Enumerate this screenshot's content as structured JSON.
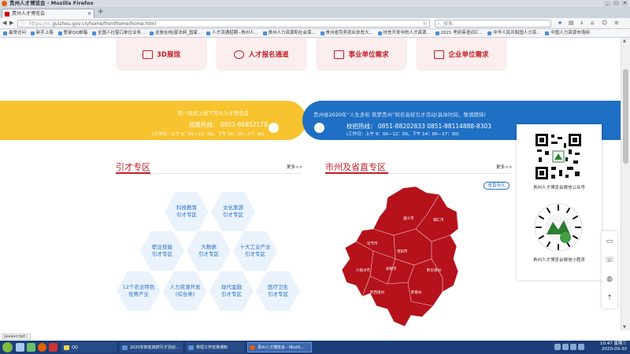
{
  "window": {
    "title": "贵州人才博览会 - Mozilla Firefox"
  },
  "tab": {
    "label": "贵州人才博览会"
  },
  "nav": {
    "url_scheme": "https://rc.",
    "url_rest": "guizhou.gov.cn/home/fronthome/home.html",
    "search_placeholder": "搜索"
  },
  "bookmarks": [
    "最常访问",
    "新手上路",
    "登录QQ邮箱",
    "全国人社窗口单位业务...",
    "这是在线|普法网_国家...",
    "人才流通招聘--贵州人...",
    "贵州人力资源和社会保...",
    "贵州省劳务就业扶贫大...",
    "扶贫开发中的人才资源...",
    "2021 考研英语词汇...",
    "中华人民共和国人力资...",
    "中国人力资源市场网"
  ],
  "tiles": [
    {
      "label": "3D展馆",
      "icon": "monitor-check-icon"
    },
    {
      "label": "人才报名通道",
      "icon": "person-add-icon"
    },
    {
      "label": "事业单位需求",
      "icon": "building-icon"
    },
    {
      "label": "企业单位需求",
      "icon": "office-building-icon"
    }
  ],
  "banner_left": {
    "line1": "第八届线上线下贵州人才博览会",
    "hotline": "组委热线：  0851-86852178",
    "hours": "(工作日：上午 9：00—12：00，下午 14：00—17：00)"
  },
  "banner_right": {
    "line1_pre": "贵州省",
    "line1_year": "2020",
    "line1_post": "年“人生多彩 筑梦贵州”知名高校引才活动(具体时间，敬请期待)",
    "hotline": "校招热线：  0851-88202833 0851-88114888-8303",
    "hours": "(工作日：上午 9：00—12：00，下午 14：00—17：00)"
  },
  "section_left": {
    "title": "引才专区",
    "more": "更多>>"
  },
  "section_right": {
    "title": "市州及省直专区",
    "more": "更多>>",
    "tag": "省直专区"
  },
  "hexes": [
    {
      "l1": "科技教育",
      "l2": "引才专区"
    },
    {
      "l1": "文化旅游",
      "l2": "引才专区"
    },
    {
      "l1": "职业技能",
      "l2": "引才专区"
    },
    {
      "l1": "大数据",
      "l2": "引才专区"
    },
    {
      "l1": "十大工业产业",
      "l2": "引才专区"
    },
    {
      "l1": "12个农业特色",
      "l2": "优势产业"
    },
    {
      "l1": "人力资源开发",
      "l2": "(综合类)"
    },
    {
      "l1": "现代金融",
      "l2": "引才专区"
    },
    {
      "l1": "医疗卫生",
      "l2": "引才专区"
    }
  ],
  "map_labels": [
    "遵义市",
    "铜仁市",
    "毕节市",
    "贵阳市",
    "安顺市",
    "黔东南州",
    "六盘水市",
    "黔西南州",
    "黔南州"
  ],
  "qr": {
    "caption1": "贵州人才博览会微信公众号",
    "caption2": "贵州人才博览会微信小程序"
  },
  "status": "javascript:;",
  "taskbar": {
    "items": [
      "QQ",
      "2020年知名高校引才活动...",
      "校招工作安排通知",
      "贵州人才博览会 - Mozill..."
    ],
    "time": "10:47 星期三",
    "date": "2020-09-30"
  },
  "colors": {
    "accent_red": "#c0202a",
    "banner_yellow": "#f7c32e",
    "banner_blue": "#1f6fc4",
    "map_red": "#b5121b"
  }
}
